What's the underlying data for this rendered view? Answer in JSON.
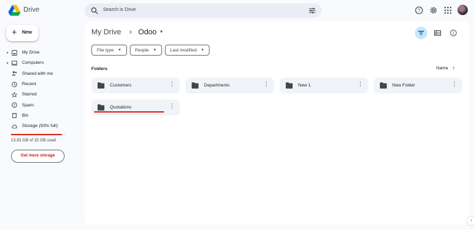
{
  "app": {
    "brand": "Drive"
  },
  "search": {
    "placeholder": "Search in Drive"
  },
  "sidebar": {
    "new_label": "New",
    "items": [
      {
        "label": "My Drive",
        "icon": "my-drive-icon"
      },
      {
        "label": "Computers",
        "icon": "computer-icon"
      },
      {
        "label": "Shared with me",
        "icon": "people-icon"
      },
      {
        "label": "Recent",
        "icon": "clock-icon"
      },
      {
        "label": "Starred",
        "icon": "star-icon"
      },
      {
        "label": "Spam",
        "icon": "spam-icon"
      },
      {
        "label": "Bin",
        "icon": "trash-icon"
      },
      {
        "label": "Storage (93% full)",
        "icon": "cloud-icon"
      }
    ],
    "storage_used_fraction": 0.93,
    "storage_text": "13.91 GB of 15 GB used",
    "get_storage_label": "Get more storage"
  },
  "breadcrumb": {
    "root": "My Drive",
    "current": "Odoo"
  },
  "filters": [
    "File type",
    "People",
    "Last modified"
  ],
  "section": {
    "folders_label": "Folders",
    "sort_label": "Name"
  },
  "folders": [
    "Customers",
    "Departments",
    "New 1",
    "New Folder",
    "Quotations"
  ],
  "colors": {
    "accent": "#c2e7ff",
    "storage_warning": "#d93025",
    "folder_bg": "#f0f4f9"
  }
}
